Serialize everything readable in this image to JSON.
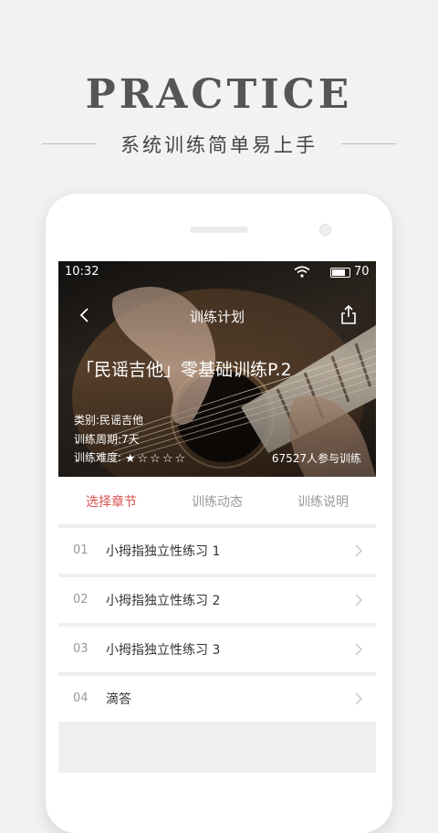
{
  "promo": {
    "title": "PRACTICE",
    "subtitle": "系统训练简单易上手"
  },
  "status_bar": {
    "time": "10:32",
    "battery": "70"
  },
  "nav": {
    "title": "训练计划",
    "back_icon": "chevron-left-icon",
    "share_icon": "share-icon"
  },
  "course": {
    "title": "「民谣吉他」零基础训练P.2",
    "category": "类别:民谣吉他",
    "period": "训练周期:7天",
    "difficulty_label": "训练难度:",
    "difficulty_stars": "★☆☆☆☆",
    "difficulty_rating": 1,
    "difficulty_max": 5,
    "participants": "67527人参与训练"
  },
  "tabs": [
    {
      "label": "选择章节",
      "active": true
    },
    {
      "label": "训练动态",
      "active": false
    },
    {
      "label": "训练说明",
      "active": false
    }
  ],
  "chapters": [
    {
      "num": "01",
      "title": "小拇指独立性练习 1"
    },
    {
      "num": "02",
      "title": "小拇指独立性练习 2"
    },
    {
      "num": "03",
      "title": "小拇指独立性练习 3"
    },
    {
      "num": "04",
      "title": "滴答"
    }
  ],
  "colors": {
    "accent": "#d9534f",
    "background": "#f2f2f2"
  }
}
